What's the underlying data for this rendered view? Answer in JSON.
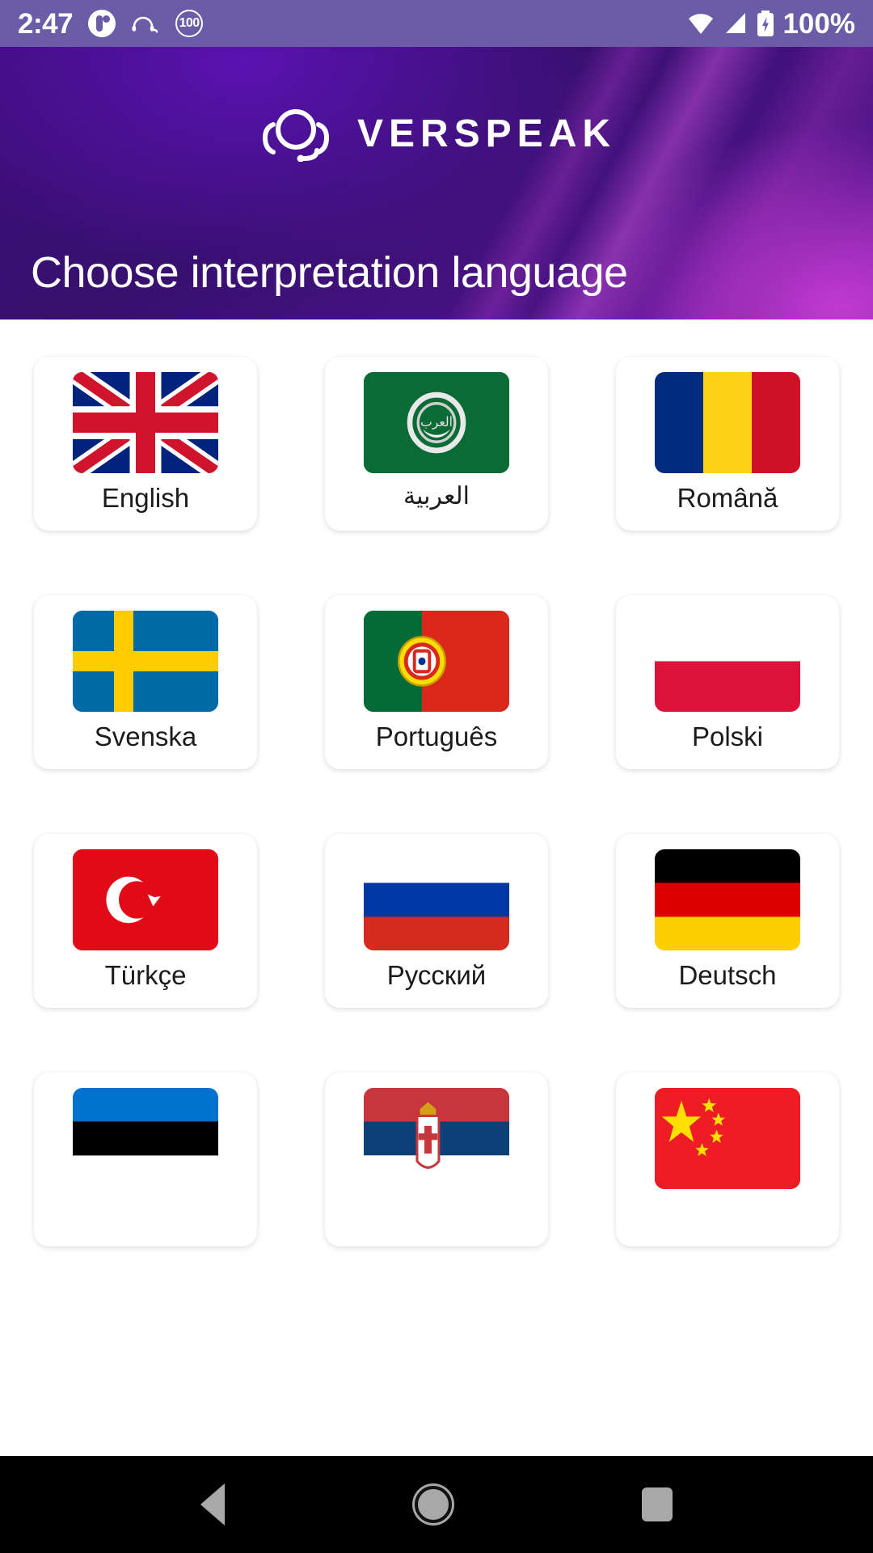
{
  "statusbar": {
    "time": "2:47",
    "battery_text": "100%",
    "speed_badge": "100",
    "icons": [
      "app-circle-icon",
      "headset-icon",
      "speed-limit-100-icon",
      "wifi-icon",
      "signal-icon",
      "battery-charging-icon"
    ]
  },
  "header": {
    "brand": "VERSPEAK",
    "logo_icon": "headset-logo-icon",
    "title": "Choose interpretation language",
    "gradient_from": "#3d0d7a",
    "gradient_to": "#6b1a9e",
    "accent": "#c23ad0"
  },
  "languages": [
    {
      "label": "English",
      "flag": "gb",
      "flag_name": "flag-united-kingdom"
    },
    {
      "label": "العربية",
      "flag": "arab",
      "flag_name": "flag-arab-league"
    },
    {
      "label": "Română",
      "flag": "ro",
      "flag_name": "flag-romania"
    },
    {
      "label": "Svenska",
      "flag": "se",
      "flag_name": "flag-sweden"
    },
    {
      "label": "Português",
      "flag": "pt",
      "flag_name": "flag-portugal"
    },
    {
      "label": "Polski",
      "flag": "pl",
      "flag_name": "flag-poland"
    },
    {
      "label": "Türkçe",
      "flag": "tr",
      "flag_name": "flag-turkey"
    },
    {
      "label": "Русский",
      "flag": "ru",
      "flag_name": "flag-russia"
    },
    {
      "label": "Deutsch",
      "flag": "de",
      "flag_name": "flag-germany"
    },
    {
      "label": "",
      "flag": "ee",
      "flag_name": "flag-estonia"
    },
    {
      "label": "",
      "flag": "rs",
      "flag_name": "flag-serbia"
    },
    {
      "label": "",
      "flag": "cn",
      "flag_name": "flag-china"
    }
  ],
  "navbar": {
    "back": "back-icon",
    "home": "home-icon",
    "recents": "recents-icon"
  }
}
